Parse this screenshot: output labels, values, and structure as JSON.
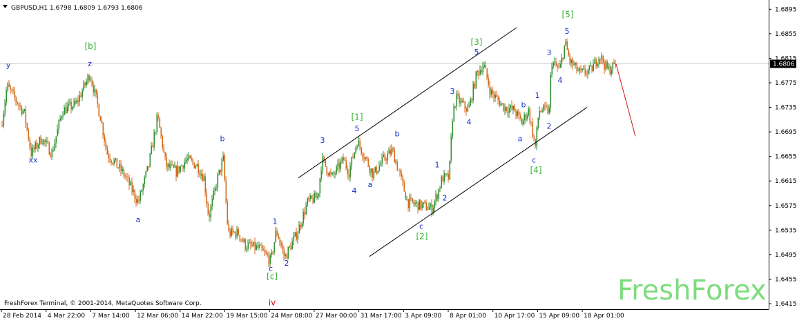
{
  "chart_data": {
    "type": "candlestick",
    "symbol_line": "GBPUSD,H1  1.6798 1.6809 1.6793 1.6806",
    "current_price": "1.6806",
    "y_ticks": [
      1.6415,
      1.6455,
      1.6495,
      1.6535,
      1.6575,
      1.6615,
      1.6655,
      1.6695,
      1.6735,
      1.6775,
      1.6815,
      1.6855,
      1.6895
    ],
    "y_tick_labels": [
      "1.6415",
      "1.6455",
      "1.6495",
      "1.6535",
      "1.6575",
      "1.6615",
      "1.6655",
      "1.6695",
      "1.6735",
      "1.6775",
      "1.6815",
      "1.6855",
      "1.6895"
    ],
    "ylim": [
      1.6406,
      1.691
    ],
    "x_tick_labels": [
      "28 Feb 2014",
      "4 Mar 22:00",
      "7 Mar 14:00",
      "12 Mar 06:00",
      "14 Mar 22:00",
      "19 Mar 15:00",
      "24 Mar 08:00",
      "27 Mar 00:00",
      "31 Mar 17:00",
      "3 Apr 09:00",
      "8 Apr 01:00",
      "10 Apr 17:00",
      "15 Apr 09:00",
      "18 Apr 01:00"
    ],
    "price_path": [
      [
        0,
        1.669
      ],
      [
        10,
        1.677
      ],
      [
        35,
        1.6725
      ],
      [
        45,
        1.666
      ],
      [
        60,
        1.6685
      ],
      [
        75,
        1.666
      ],
      [
        90,
        1.673
      ],
      [
        110,
        1.674
      ],
      [
        130,
        1.679
      ],
      [
        145,
        1.672
      ],
      [
        155,
        1.666
      ],
      [
        180,
        1.6625
      ],
      [
        200,
        1.658
      ],
      [
        215,
        1.664
      ],
      [
        228,
        1.672
      ],
      [
        240,
        1.664
      ],
      [
        255,
        1.663
      ],
      [
        270,
        1.665
      ],
      [
        285,
        1.664
      ],
      [
        295,
        1.662
      ],
      [
        302,
        1.6555
      ],
      [
        315,
        1.662
      ],
      [
        323,
        1.665
      ],
      [
        330,
        1.653
      ],
      [
        345,
        1.653
      ],
      [
        355,
        1.651
      ],
      [
        375,
        1.6505
      ],
      [
        392,
        1.6485
      ],
      [
        400,
        1.6535
      ],
      [
        412,
        1.649
      ],
      [
        430,
        1.653
      ],
      [
        445,
        1.658
      ],
      [
        460,
        1.659
      ],
      [
        466,
        1.665
      ],
      [
        480,
        1.662
      ],
      [
        497,
        1.665
      ],
      [
        505,
        1.663
      ],
      [
        517,
        1.668
      ],
      [
        530,
        1.665
      ],
      [
        540,
        1.6625
      ],
      [
        555,
        1.665
      ],
      [
        568,
        1.6665
      ],
      [
        580,
        1.662
      ],
      [
        590,
        1.658
      ],
      [
        610,
        1.6575
      ],
      [
        625,
        1.657
      ],
      [
        632,
        1.659
      ],
      [
        640,
        1.662
      ],
      [
        650,
        1.662
      ],
      [
        655,
        1.672
      ],
      [
        660,
        1.675
      ],
      [
        678,
        1.673
      ],
      [
        690,
        1.679
      ],
      [
        700,
        1.6805
      ],
      [
        710,
        1.676
      ],
      [
        730,
        1.6735
      ],
      [
        745,
        1.673
      ],
      [
        755,
        1.671
      ],
      [
        765,
        1.673
      ],
      [
        775,
        1.667
      ],
      [
        780,
        1.673
      ],
      [
        795,
        1.673
      ],
      [
        798,
        1.681
      ],
      [
        810,
        1.6795
      ],
      [
        818,
        1.684
      ],
      [
        825,
        1.681
      ],
      [
        840,
        1.679
      ],
      [
        855,
        1.6795
      ],
      [
        868,
        1.682
      ],
      [
        880,
        1.6795
      ],
      [
        892,
        1.6806
      ]
    ],
    "projection": [
      [
        892,
        1.6806
      ],
      [
        920,
        1.6688
      ]
    ],
    "channel_upper": [
      [
        432,
        1.662
      ],
      [
        748,
        1.6865
      ]
    ],
    "channel_lower": [
      [
        535,
        1.6492
      ],
      [
        850,
        1.6735
      ]
    ],
    "labels": [
      {
        "text": "y",
        "x": 12,
        "price": 1.68,
        "color": "blue"
      },
      {
        "text": "xx",
        "x": 48,
        "price": 1.6645,
        "color": "blue"
      },
      {
        "text": "[b]",
        "x": 131,
        "price": 1.683,
        "color": "green"
      },
      {
        "text": "z",
        "x": 130,
        "price": 1.6802,
        "color": "blue"
      },
      {
        "text": "a",
        "x": 200,
        "price": 1.6548,
        "color": "blue"
      },
      {
        "text": "b",
        "x": 322,
        "price": 1.668,
        "color": "blue"
      },
      {
        "text": "1",
        "x": 398,
        "price": 1.6545,
        "color": "blue"
      },
      {
        "text": "2",
        "x": 415,
        "price": 1.6477,
        "color": "blue"
      },
      {
        "text": "c",
        "x": 392,
        "price": 1.6468,
        "color": "blue"
      },
      {
        "text": "[c]",
        "x": 394,
        "price": 1.6455,
        "color": "green"
      },
      {
        "text": "iv",
        "x": 394,
        "price": 1.6412,
        "color": "red"
      },
      {
        "text": "3",
        "x": 467,
        "price": 1.6677,
        "color": "blue"
      },
      {
        "text": "4",
        "x": 513,
        "price": 1.6595,
        "color": "blue"
      },
      {
        "text": "[1]",
        "x": 517,
        "price": 1.6715,
        "color": "green"
      },
      {
        "text": "5",
        "x": 517,
        "price": 1.6696,
        "color": "blue"
      },
      {
        "text": "a",
        "x": 536,
        "price": 1.6605,
        "color": "blue"
      },
      {
        "text": "b",
        "x": 575,
        "price": 1.6688,
        "color": "blue"
      },
      {
        "text": "c",
        "x": 610,
        "price": 1.6537,
        "color": "blue"
      },
      {
        "text": "[2]",
        "x": 611,
        "price": 1.652,
        "color": "green"
      },
      {
        "text": "1",
        "x": 633,
        "price": 1.6637,
        "color": "blue"
      },
      {
        "text": "2",
        "x": 644,
        "price": 1.6583,
        "color": "blue"
      },
      {
        "text": "3",
        "x": 655,
        "price": 1.6757,
        "color": "blue"
      },
      {
        "text": "4",
        "x": 679,
        "price": 1.6707,
        "color": "blue"
      },
      {
        "text": "[3]",
        "x": 690,
        "price": 1.6837,
        "color": "green"
      },
      {
        "text": "5",
        "x": 690,
        "price": 1.6821,
        "color": "blue"
      },
      {
        "text": "1",
        "x": 778,
        "price": 1.675,
        "color": "blue"
      },
      {
        "text": "b",
        "x": 758,
        "price": 1.6735,
        "color": "blue"
      },
      {
        "text": "a",
        "x": 753,
        "price": 1.668,
        "color": "blue"
      },
      {
        "text": "2",
        "x": 795,
        "price": 1.67,
        "color": "blue"
      },
      {
        "text": "c",
        "x": 773,
        "price": 1.6645,
        "color": "blue"
      },
      {
        "text": "[4]",
        "x": 776,
        "price": 1.6628,
        "color": "green"
      },
      {
        "text": "3",
        "x": 795,
        "price": 1.682,
        "color": "blue"
      },
      {
        "text": "4",
        "x": 811,
        "price": 1.6775,
        "color": "blue"
      },
      {
        "text": "[5]",
        "x": 822,
        "price": 1.6882,
        "color": "green"
      },
      {
        "text": "5",
        "x": 821,
        "price": 1.6855,
        "color": "blue"
      }
    ],
    "colors": {
      "up": "#2f8f2f",
      "down": "#d46a1a",
      "channel": "#000000",
      "projection": "#cc1111",
      "wave_major": "#36b336",
      "wave_minor": "#1a2fd1",
      "wave_cycle": "#cc1111",
      "price_marker_bg": "#000000"
    }
  },
  "footer": {
    "copyright": "FreshForex Terminal, © 2001-2014, MetaQuotes Software Corp."
  },
  "brand": {
    "watermark": "FreshForex"
  },
  "header": {
    "dropdown_icon": "dropdown-triangle-icon"
  }
}
